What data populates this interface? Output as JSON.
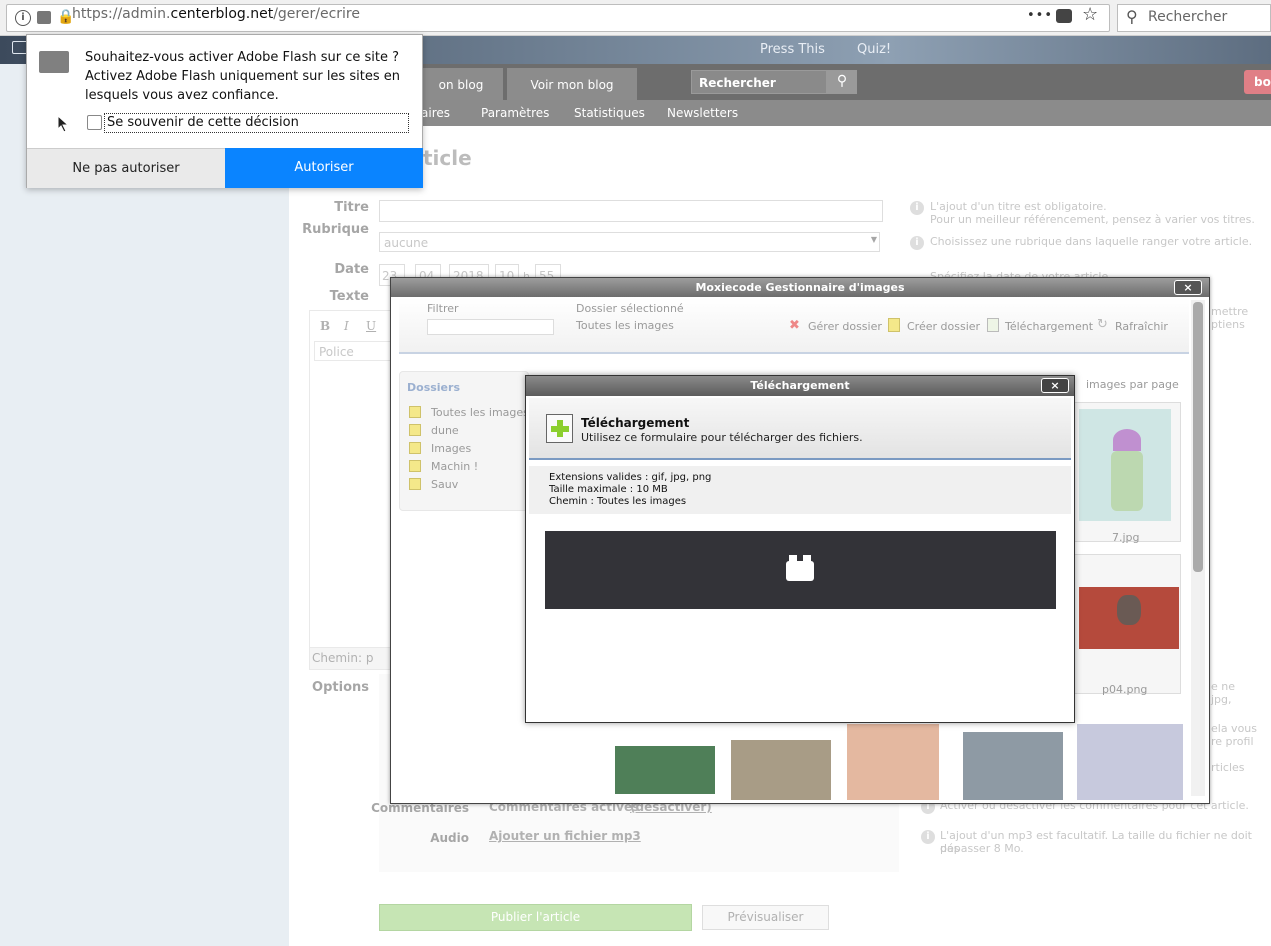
{
  "browser": {
    "url_prefix": "https://admin.",
    "url_domain": "centerblog.net",
    "url_path": "/gerer/ecrire",
    "search_placeholder": "Rechercher",
    "more_icon": "•••"
  },
  "bookmarks": {
    "press_this": "Press This",
    "quiz": "Quiz!"
  },
  "site": {
    "tab1": "on blog",
    "tab2": "Voir mon blog",
    "search_placeholder": "Rechercher",
    "user_badge": "bo",
    "sub_nav": [
      "aires",
      "Paramètres",
      "Statistiques",
      "Newsletters"
    ],
    "page_title": "ticle"
  },
  "form": {
    "titre_label": "Titre",
    "rubrique_label": "Rubrique",
    "rubrique_value": "aucune",
    "date_label": "Date",
    "date_day": "23",
    "date_month": "04",
    "date_year": "2018",
    "date_hour": "10",
    "date_sep_h": "h",
    "date_min": "55",
    "texte_label": "Texte",
    "font_placeholder": "Police",
    "path_label": "Chemin: p",
    "options_label": "Options",
    "commentaires_label": "Commentaires",
    "commentaires_value": "Commentaires activés",
    "commentaires_link": "(désactiver)",
    "audio_label": "Audio",
    "audio_link": "Ajouter un fichier mp3",
    "publish_button": "Publier l'article",
    "preview_button": "Prévisualiser"
  },
  "help": {
    "titre_1": "L'ajout d'un titre est obligatoire.",
    "titre_2": "Pour un meilleur référencement, pensez à varier vos titres.",
    "rubrique": "Choisissez une rubrique dans laquelle ranger votre article.",
    "date": "Spécifiez la date de votre article.",
    "texte_1": "mettre",
    "texte_2": "ptiens",
    "options_1": "e ne",
    "options_2": "jpg,",
    "options_3": "ela vous",
    "options_4": "re profil",
    "options_5": "rticles",
    "commentaires": "Activer ou désactiver les commentaires pour cet article.",
    "audio_1": "L'ajout d'un mp3 est facultatif. La taille du fichier ne doit pas",
    "audio_2": "dépasser 8 Mo."
  },
  "moxie": {
    "title": "Moxiecode Gestionnaire d'images",
    "close": "×",
    "filter_label": "Filtrer",
    "selected_folder_label": "Dossier sélectionné",
    "selected_folder_value": "Toutes les images",
    "manage_folder": "Gérer dossier",
    "create_folder": "Créer dossier",
    "upload": "Téléchargement",
    "refresh": "Rafraîchir",
    "folders_title": "Dossiers",
    "folders": [
      "Toutes les images",
      "dune",
      "Images",
      "Machin !",
      "Sauv"
    ],
    "per_page": "images par page",
    "thumb_labels": [
      "7.jpg",
      "p04.png"
    ]
  },
  "upload_dialog": {
    "title": "Téléchargement",
    "close": "×",
    "heading": "Téléchargement",
    "subheading": "Utilisez ce formulaire pour télécharger des fichiers.",
    "extensions": "Extensions valides : gif, jpg, png",
    "max_size": "Taille maximale : 10 MB",
    "path": "Chemin : Toutes les images"
  },
  "flash_popup": {
    "question_1": "Souhaitez-vous activer Adobe Flash sur ce site ?",
    "question_2": "Activez Adobe Flash uniquement sur les sites en",
    "question_3": "lesquels vous avez confiance.",
    "remember": "Se souvenir de cette décision",
    "deny_button": "Ne pas autoriser",
    "allow_button": "Autoriser"
  },
  "colors": {
    "allow_blue": "#0a84ff",
    "publish_green": "#a8d88c",
    "site_header": "#6d6d6d"
  }
}
